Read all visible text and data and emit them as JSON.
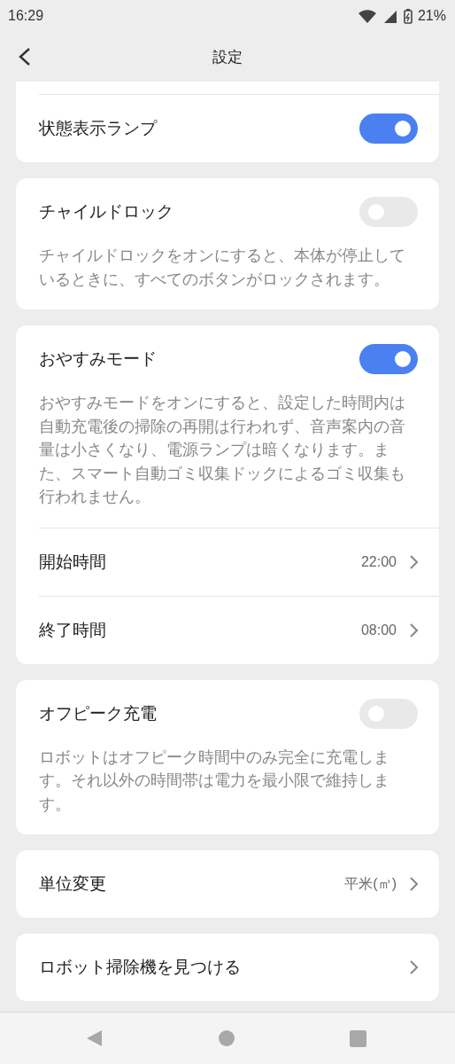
{
  "status_bar": {
    "time": "16:29",
    "battery": "21%"
  },
  "header": {
    "title": "設定"
  },
  "cards": [
    {
      "cut_top": true,
      "items": [
        {
          "kind": "toggle",
          "label": "状態表示ランプ",
          "on": true
        }
      ]
    },
    {
      "cut_top": false,
      "items": [
        {
          "kind": "toggle",
          "label": "チャイルドロック",
          "on": false
        },
        {
          "kind": "note",
          "text": "チャイルドロックをオンにすると、本体が停止しているときに、すべてのボタンがロックされます。"
        }
      ]
    },
    {
      "cut_top": false,
      "items": [
        {
          "kind": "toggle",
          "label": "おやすみモード",
          "on": true
        },
        {
          "kind": "note",
          "text": "おやすみモードをオンにすると、設定した時間内は自動充電後の掃除の再開は行われず、音声案内の音量は小さくなり、電源ランプは暗くなります。また、スマート自動ゴミ収集ドックによるゴミ収集も行われません。"
        },
        {
          "kind": "link",
          "label": "開始時間",
          "value": "22:00"
        },
        {
          "kind": "link",
          "label": "終了時間",
          "value": "08:00"
        }
      ]
    },
    {
      "cut_top": false,
      "items": [
        {
          "kind": "toggle",
          "label": "オフピーク充電",
          "on": false
        },
        {
          "kind": "note",
          "text": "ロボットはオフピーク時間中のみ完全に充電します。それ以外の時間帯は電力を最小限で維持します。"
        }
      ]
    },
    {
      "cut_top": false,
      "items": [
        {
          "kind": "link",
          "label": "単位変更",
          "value": "平米(㎡)"
        }
      ]
    },
    {
      "cut_top": false,
      "items": [
        {
          "kind": "link",
          "label": "ロボット掃除機を見つける"
        }
      ]
    }
  ]
}
